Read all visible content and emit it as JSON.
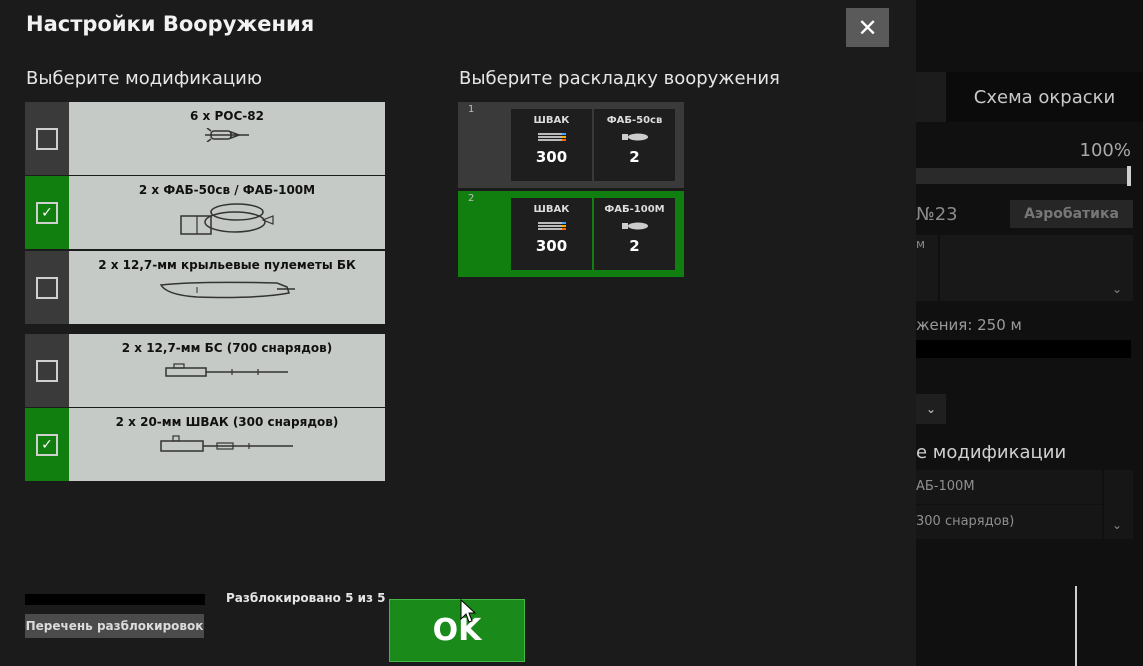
{
  "background": {
    "tab_label": "Схема окраски",
    "percent": "100%",
    "number": "№23",
    "aerobatics_label": "Аэробатика",
    "box_fragment": "м",
    "distance_fragment": "жения: 250 м",
    "modifications_fragment": "е модификации",
    "row1_fragment": "АБ-100М",
    "row2_fragment": "300 снарядов)"
  },
  "dialog": {
    "title": "Настройки Вооружения",
    "close_icon": "close-icon"
  },
  "modifications": {
    "title": "Выберите модификацию",
    "items": [
      {
        "name": "6 x РОС-82",
        "checked": false,
        "icon": "rocket-icon"
      },
      {
        "name": "2 x ФАБ-50св / ФАБ-100М",
        "checked": true,
        "icon": "bomb-icon"
      },
      {
        "name": "2 x 12,7-мм крыльевые пулеметы БК",
        "checked": false,
        "icon": "wing-gun-icon"
      },
      {
        "name": "2 x 12,7-мм БС (700 снарядов)",
        "checked": false,
        "icon": "machine-gun-icon"
      },
      {
        "name": "2 x 20-мм ШВАК (300 снарядов)",
        "checked": true,
        "icon": "cannon-icon"
      }
    ]
  },
  "loadouts": {
    "title": "Выберите раскладку вооружения",
    "items": [
      {
        "index": "1",
        "selected": false,
        "slots": [
          {
            "name": "ШВАК",
            "count": "300",
            "icon": "ammo-belt-icon"
          },
          {
            "name": "ФАБ-50св",
            "count": "2",
            "icon": "bomb-small-icon"
          }
        ]
      },
      {
        "index": "2",
        "selected": true,
        "slots": [
          {
            "name": "ШВАК",
            "count": "300",
            "icon": "ammo-belt-icon"
          },
          {
            "name": "ФАБ-100М",
            "count": "2",
            "icon": "bomb-small-icon"
          }
        ]
      }
    ]
  },
  "footer": {
    "unlock_progress": 1.0,
    "unlock_text": "Разблокировано 5 из 5",
    "unlock_list_button": "Перечень разблокировок",
    "ok_button": "OK"
  },
  "colors": {
    "accent_green": "#107f10",
    "item_background": "#c6cac6",
    "checkbox_off_background": "#3a3a3a"
  }
}
